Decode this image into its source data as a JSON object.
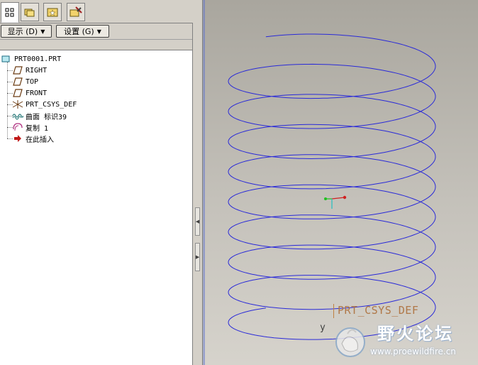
{
  "tabs": [
    {
      "name": "model-tree-tab",
      "icon": "model-tree-icon",
      "active": true
    },
    {
      "name": "folder-browser-tab",
      "icon": "folder-icon",
      "active": false
    },
    {
      "name": "favorites-tab",
      "icon": "favorites-icon",
      "active": false
    },
    {
      "name": "connections-tab",
      "icon": "connections-icon",
      "active": false
    }
  ],
  "toolbar": {
    "show_label": "显示 (D)",
    "settings_label": "设置 (G)"
  },
  "tree": {
    "root": "PRT0001.PRT",
    "items": [
      {
        "label": "RIGHT",
        "icon": "datum-plane-icon"
      },
      {
        "label": "TOP",
        "icon": "datum-plane-icon"
      },
      {
        "label": "FRONT",
        "icon": "datum-plane-icon"
      },
      {
        "label": "PRT_CSYS_DEF",
        "icon": "csys-icon"
      },
      {
        "label": "曲面 标识39",
        "icon": "surface-icon"
      },
      {
        "label": "复制 1",
        "icon": "copy-icon"
      },
      {
        "label": "在此插入",
        "icon": "insert-here-arrow-icon"
      }
    ]
  },
  "viewport": {
    "csys_label": "PRT_CSYS_DEF",
    "axis_y_label": "y",
    "curve_color": "#2a2ad8"
  },
  "watermark": {
    "title": "野火论坛",
    "url": "www.proewildfire.cn"
  }
}
